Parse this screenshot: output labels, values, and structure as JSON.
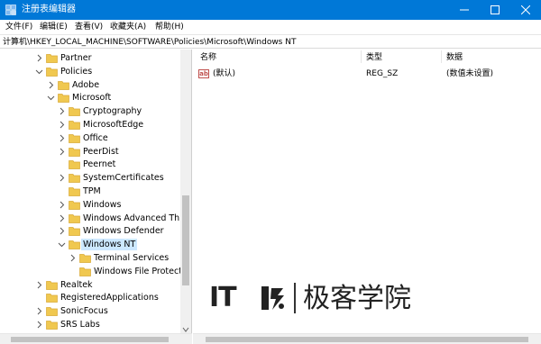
{
  "window": {
    "title": "注册表编辑器",
    "accent": "#0078d7",
    "controls": [
      "minimize",
      "maximize",
      "close"
    ]
  },
  "menu": [
    "文件(F)",
    "编辑(E)",
    "查看(V)",
    "收藏夹(A)",
    "帮助(H)"
  ],
  "address": "计算机\\HKEY_LOCAL_MACHINE\\SOFTWARE\\Policies\\Microsoft\\Windows NT",
  "tree": {
    "items": [
      {
        "label": "Partner",
        "expander": "collapsed"
      },
      {
        "label": "Policies",
        "expander": "expanded"
      },
      {
        "label": "Adobe",
        "expander": "collapsed"
      },
      {
        "label": "Microsoft",
        "expander": "expanded"
      },
      {
        "label": "Cryptography",
        "expander": "collapsed"
      },
      {
        "label": "MicrosoftEdge",
        "expander": "collapsed"
      },
      {
        "label": "Office",
        "expander": "collapsed"
      },
      {
        "label": "PeerDist",
        "expander": "collapsed"
      },
      {
        "label": "Peernet",
        "expander": "none"
      },
      {
        "label": "SystemCertificates",
        "expander": "collapsed"
      },
      {
        "label": "TPM",
        "expander": "none"
      },
      {
        "label": "Windows",
        "expander": "collapsed"
      },
      {
        "label": "Windows Advanced Threa",
        "expander": "collapsed"
      },
      {
        "label": "Windows Defender",
        "expander": "collapsed"
      },
      {
        "label": "Windows NT",
        "expander": "expanded",
        "selected": true
      },
      {
        "label": "Terminal Services",
        "expander": "collapsed"
      },
      {
        "label": "Windows File Protectic",
        "expander": "none"
      },
      {
        "label": "Realtek",
        "expander": "collapsed"
      },
      {
        "label": "RegisteredApplications",
        "expander": "none"
      },
      {
        "label": "SonicFocus",
        "expander": "collapsed"
      },
      {
        "label": "SRS Labs",
        "expander": "collapsed"
      }
    ]
  },
  "values": {
    "columns": [
      "名称",
      "类型",
      "数据"
    ],
    "rows": [
      {
        "name": "(默认)",
        "type": "REG_SZ",
        "data": "(数值未设置)",
        "icon": "string-value-icon"
      }
    ]
  },
  "watermark": {
    "logo": "IT",
    "brand": "极客学院"
  },
  "colors": {
    "folder": "#f0c850",
    "selection": "#cce8ff"
  }
}
